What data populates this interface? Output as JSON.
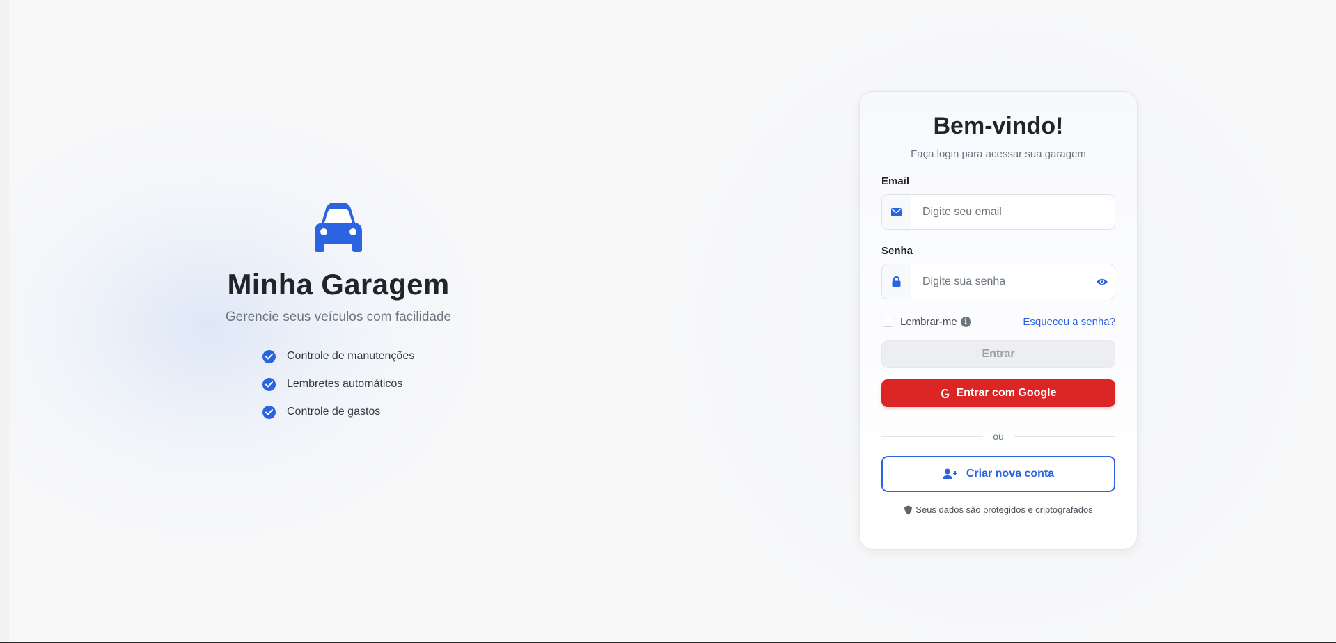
{
  "colors": {
    "primary": "#2a64e0",
    "danger": "#dc2626",
    "muted": "#6c757d",
    "background": "#f8f8f9"
  },
  "hero": {
    "icon": "car-icon",
    "title": "Minha Garagem",
    "tagline": "Gerencie seus veículos com facilidade",
    "features": [
      {
        "icon": "check-circle-icon",
        "label": "Controle de manutenções"
      },
      {
        "icon": "check-circle-icon",
        "label": "Lembretes automáticos"
      },
      {
        "icon": "check-circle-icon",
        "label": "Controle de gastos"
      }
    ]
  },
  "login": {
    "title": "Bem-vindo!",
    "subtitle": "Faça login para acessar sua garagem",
    "email": {
      "label": "Email",
      "icon": "envelope-icon",
      "value": "",
      "placeholder": "Digite seu email"
    },
    "password": {
      "label": "Senha",
      "icon": "lock-icon",
      "value": "",
      "placeholder": "Digite sua senha",
      "toggle_icon": "eye-icon"
    },
    "remember": {
      "label": "Lembrar-me",
      "checked": false,
      "info_icon": "info-icon"
    },
    "forgot_label": "Esqueceu a senha?",
    "submit_label": "Entrar",
    "google_label": "Entrar com Google",
    "divider_label": "ou",
    "create_label": "Criar nova conta",
    "security_note": "Seus dados são protegidos e criptografados"
  }
}
